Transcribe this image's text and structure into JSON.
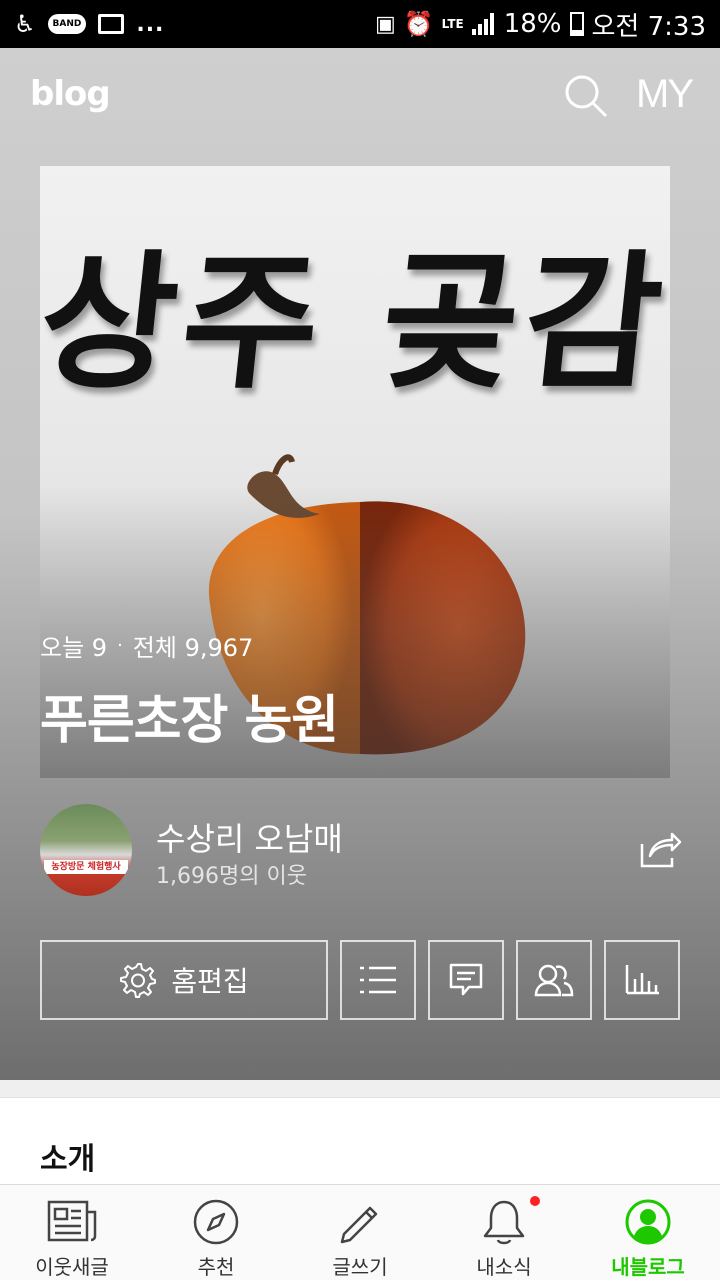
{
  "status_bar": {
    "band_label": "BAND",
    "overflow": "...",
    "network": "LTE",
    "battery": "18%",
    "time": "오전 7:33"
  },
  "topbar": {
    "logo": "blog",
    "my_label": "MY"
  },
  "hero": {
    "calligraphy": "상주 곶감",
    "stats": {
      "today": "오늘 9",
      "separator": "·",
      "total": "전체 9,967"
    },
    "title": "푸른초장 농원"
  },
  "owner": {
    "avatar_banner": "농장방문 체험행사",
    "name": "수상리 오남매",
    "neighbors": "1,696명의 이웃"
  },
  "actions": {
    "edit_label": "홈편집"
  },
  "section": {
    "intro_title": "소개"
  },
  "bottom_nav": {
    "items": [
      {
        "label": "이웃새글",
        "icon": "news-icon"
      },
      {
        "label": "추천",
        "icon": "compass-icon"
      },
      {
        "label": "글쓰기",
        "icon": "pencil-icon"
      },
      {
        "label": "내소식",
        "icon": "bell-icon"
      },
      {
        "label": "내블로그",
        "icon": "profile-icon"
      }
    ],
    "active_index": 4,
    "active_color": "#1ec800"
  }
}
